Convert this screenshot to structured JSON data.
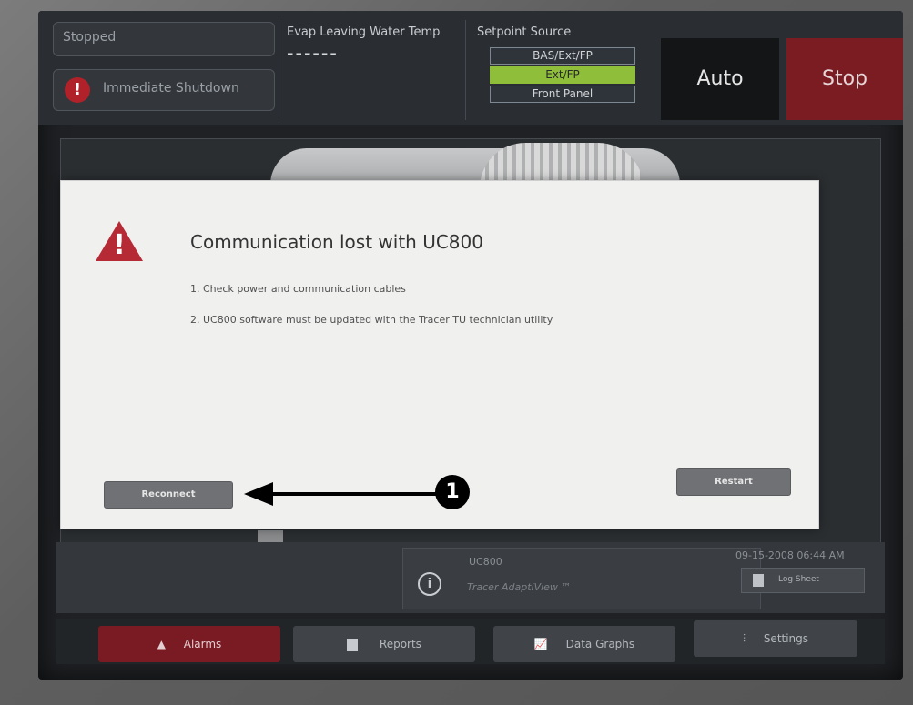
{
  "status": {
    "state": "Stopped",
    "alarm": "Immediate Shutdown"
  },
  "evap": {
    "label": "Evap Leaving Water Temp",
    "value": "------"
  },
  "setpoint": {
    "label": "Setpoint Source",
    "options": [
      "BAS/Ext/FP",
      "Ext/FP",
      "Front Panel"
    ],
    "selected": "Ext/FP"
  },
  "modes": {
    "auto": "Auto",
    "stop": "Stop"
  },
  "dialog": {
    "title": "Communication lost with UC800",
    "line1": "1. Check power and communication cables",
    "line2": "2. UC800 software must be updated with the Tracer TU technician utility",
    "reconnect": "Reconnect",
    "restart": "Restart"
  },
  "callout": {
    "number": "1"
  },
  "info": {
    "device": "UC800",
    "product": "Tracer AdaptiView ™",
    "datetime": "09-15-2008 06:44 AM",
    "log_sheet": "Log Sheet"
  },
  "nav": {
    "alarms": "Alarms",
    "reports": "Reports",
    "data_graphs": "Data Graphs",
    "settings": "Settings"
  },
  "colors": {
    "alarm_red": "#b0212a",
    "active_green": "#8fbf3a",
    "stop_red": "#7a1c22"
  }
}
